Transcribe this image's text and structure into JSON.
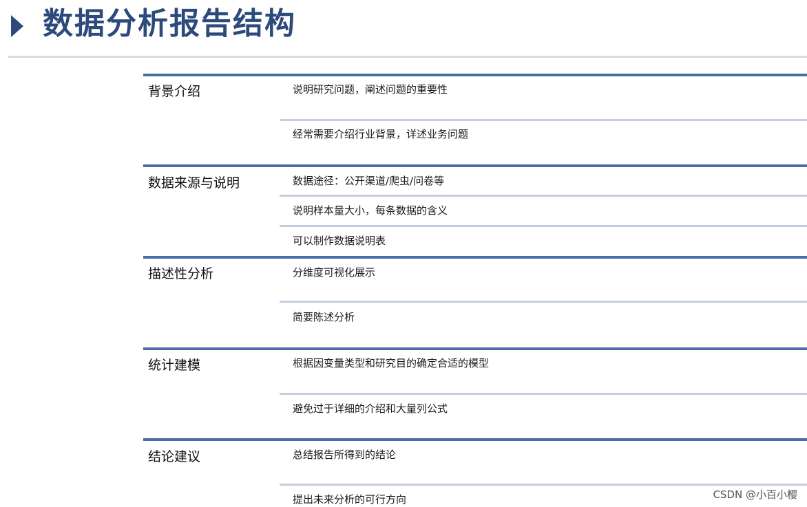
{
  "title": "数据分析报告结构",
  "sections": [
    {
      "category": "背景介绍",
      "items": [
        "说明研究问题，阐述问题的重要性",
        "经常需要介绍行业背景，详述业务问题"
      ]
    },
    {
      "category": "数据来源与说明",
      "items": [
        "数据途径：公开渠道/爬虫/问卷等",
        "说明样本量大小，每条数据的含义",
        "可以制作数据说明表"
      ]
    },
    {
      "category": "描述性分析",
      "items": [
        "分维度可视化展示",
        "简要陈述分析"
      ]
    },
    {
      "category": "统计建模",
      "items": [
        "根据因变量类型和研究目的确定合适的模型",
        "避免过于详细的介绍和大量列公式"
      ]
    },
    {
      "category": "结论建议",
      "items": [
        "总结报告所得到的结论",
        "提出未来分析的可行方向"
      ]
    }
  ],
  "watermark": "CSDN @小百小樱",
  "colors": {
    "title": "#2d4a7c",
    "section_rule": "#4a6ea9",
    "item_rule": "#c5cee0"
  }
}
